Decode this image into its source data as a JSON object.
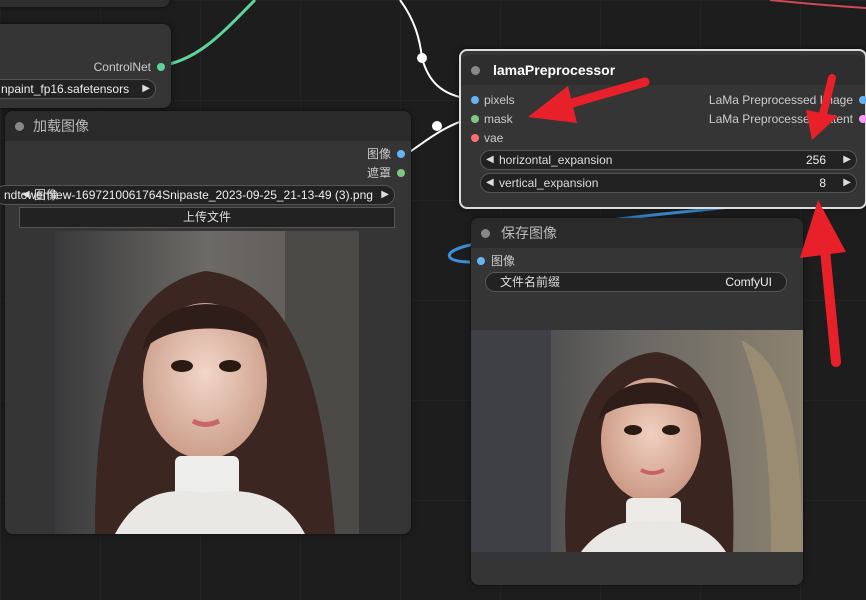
{
  "colors": {
    "canvas": "#1d1d1d",
    "node_body": "#353535",
    "node_title": "#2a2a2a",
    "link_green": "#5fd39a",
    "link_white": "#ffffff",
    "link_blue": "#3a8fd8",
    "slot_image": "#64b5f6",
    "slot_mask": "#81c784",
    "slot_vae": "#ff6e6e",
    "slot_latent": "#ff9cf9",
    "annotation_red": "#e8202a"
  },
  "controlnet_node": {
    "output_label": "ControlNet",
    "model_value": "npaint_fp16.safetensors"
  },
  "load_image_node": {
    "title": "加载图像",
    "outputs": [
      "图像",
      "遮罩"
    ],
    "image_file": "ndtowerhiew-1697210061764Snipaste_2023-09-25_21-13-49 (3).png",
    "image_overlay_label": "图像",
    "upload_button": "上传文件"
  },
  "lama_node": {
    "title": "lamaPreprocessor",
    "inputs": [
      "pixels",
      "mask",
      "vae"
    ],
    "outputs": [
      "LaMa Preprocessed Image",
      "LaMa Preprocessed Latent"
    ],
    "widgets": [
      {
        "label": "horizontal_expansion",
        "value": "256"
      },
      {
        "label": "vertical_expansion",
        "value": "8"
      }
    ]
  },
  "save_image_node": {
    "title": "保存图像",
    "input": "图像",
    "widget_label": "文件名前缀",
    "widget_value": "ComfyUI"
  }
}
